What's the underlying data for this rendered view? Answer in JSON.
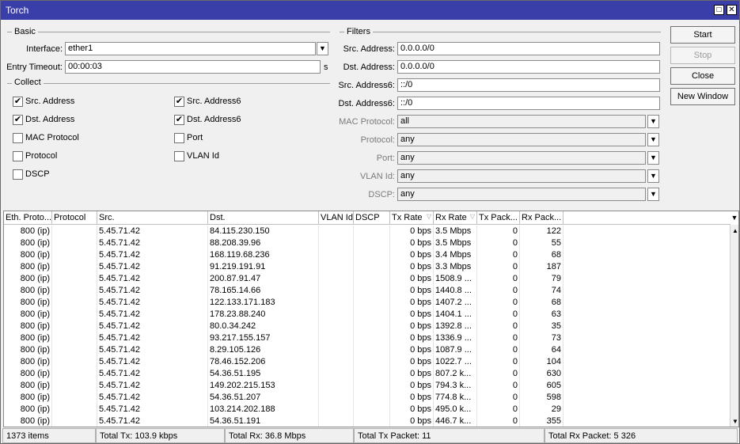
{
  "window": {
    "title": "Torch"
  },
  "basic": {
    "group_label": "Basic",
    "interface_label": "Interface:",
    "interface_value": "ether1",
    "entry_timeout_label": "Entry Timeout:",
    "entry_timeout_value": "00:00:03",
    "entry_timeout_unit": "s"
  },
  "collect": {
    "group_label": "Collect",
    "items": [
      {
        "label": "Src. Address",
        "checked": true
      },
      {
        "label": "Dst. Address",
        "checked": true
      },
      {
        "label": "MAC Protocol",
        "checked": false
      },
      {
        "label": "Protocol",
        "checked": false
      },
      {
        "label": "DSCP",
        "checked": false
      },
      {
        "label": "Src. Address6",
        "checked": true
      },
      {
        "label": "Dst. Address6",
        "checked": true
      },
      {
        "label": "Port",
        "checked": false
      },
      {
        "label": "VLAN Id",
        "checked": false
      }
    ]
  },
  "filters": {
    "group_label": "Filters",
    "src_address_label": "Src. Address:",
    "src_address_value": "0.0.0.0/0",
    "dst_address_label": "Dst. Address:",
    "dst_address_value": "0.0.0.0/0",
    "src_address6_label": "Src. Address6:",
    "src_address6_value": "::/0",
    "dst_address6_label": "Dst. Address6:",
    "dst_address6_value": "::/0",
    "mac_protocol_label": "MAC Protocol:",
    "mac_protocol_value": "all",
    "protocol_label": "Protocol:",
    "protocol_value": "any",
    "port_label": "Port:",
    "port_value": "any",
    "vlan_id_label": "VLAN Id:",
    "vlan_id_value": "any",
    "dscp_label": "DSCP:",
    "dscp_value": "any"
  },
  "buttons": {
    "start": "Start",
    "stop": "Stop",
    "close": "Close",
    "new_window": "New Window"
  },
  "table": {
    "columns": [
      "Eth. Proto...",
      "Protocol",
      "Src.",
      "Dst.",
      "VLAN Id",
      "DSCP",
      "Tx Rate",
      "Rx Rate",
      "Tx Pack...",
      "Rx Pack..."
    ],
    "rows": [
      [
        "800 (ip)",
        "",
        "5.45.71.42",
        "84.115.230.150",
        "",
        "",
        "0 bps",
        "3.5 Mbps",
        "0",
        "122"
      ],
      [
        "800 (ip)",
        "",
        "5.45.71.42",
        "88.208.39.96",
        "",
        "",
        "0 bps",
        "3.5 Mbps",
        "0",
        "55"
      ],
      [
        "800 (ip)",
        "",
        "5.45.71.42",
        "168.119.68.236",
        "",
        "",
        "0 bps",
        "3.4 Mbps",
        "0",
        "68"
      ],
      [
        "800 (ip)",
        "",
        "5.45.71.42",
        "91.219.191.91",
        "",
        "",
        "0 bps",
        "3.3 Mbps",
        "0",
        "187"
      ],
      [
        "800 (ip)",
        "",
        "5.45.71.42",
        "200.87.91.47",
        "",
        "",
        "0 bps",
        "1508.9 ...",
        "0",
        "79"
      ],
      [
        "800 (ip)",
        "",
        "5.45.71.42",
        "78.165.14.66",
        "",
        "",
        "0 bps",
        "1440.8 ...",
        "0",
        "74"
      ],
      [
        "800 (ip)",
        "",
        "5.45.71.42",
        "122.133.171.183",
        "",
        "",
        "0 bps",
        "1407.2 ...",
        "0",
        "68"
      ],
      [
        "800 (ip)",
        "",
        "5.45.71.42",
        "178.23.88.240",
        "",
        "",
        "0 bps",
        "1404.1 ...",
        "0",
        "63"
      ],
      [
        "800 (ip)",
        "",
        "5.45.71.42",
        "80.0.34.242",
        "",
        "",
        "0 bps",
        "1392.8 ...",
        "0",
        "35"
      ],
      [
        "800 (ip)",
        "",
        "5.45.71.42",
        "93.217.155.157",
        "",
        "",
        "0 bps",
        "1336.9 ...",
        "0",
        "73"
      ],
      [
        "800 (ip)",
        "",
        "5.45.71.42",
        "8.29.105.126",
        "",
        "",
        "0 bps",
        "1087.9 ...",
        "0",
        "64"
      ],
      [
        "800 (ip)",
        "",
        "5.45.71.42",
        "78.46.152.206",
        "",
        "",
        "0 bps",
        "1022.7 ...",
        "0",
        "104"
      ],
      [
        "800 (ip)",
        "",
        "5.45.71.42",
        "54.36.51.195",
        "",
        "",
        "0 bps",
        "807.2 k...",
        "0",
        "630"
      ],
      [
        "800 (ip)",
        "",
        "5.45.71.42",
        "149.202.215.153",
        "",
        "",
        "0 bps",
        "794.3 k...",
        "0",
        "605"
      ],
      [
        "800 (ip)",
        "",
        "5.45.71.42",
        "54.36.51.207",
        "",
        "",
        "0 bps",
        "774.8 k...",
        "0",
        "598"
      ],
      [
        "800 (ip)",
        "",
        "5.45.71.42",
        "103.214.202.188",
        "",
        "",
        "0 bps",
        "495.0 k...",
        "0",
        "29"
      ],
      [
        "800 (ip)",
        "",
        "5.45.71.42",
        "54.36.51.191",
        "",
        "",
        "0 bps",
        "446.7 k...",
        "0",
        "355"
      ]
    ]
  },
  "status": {
    "items": "1373 items",
    "total_tx": "Total Tx: 103.9 kbps",
    "total_rx": "Total Rx: 36.8 Mbps",
    "total_tx_packet": "Total Tx Packet: 11",
    "total_rx_packet": "Total Rx Packet: 5 326"
  }
}
